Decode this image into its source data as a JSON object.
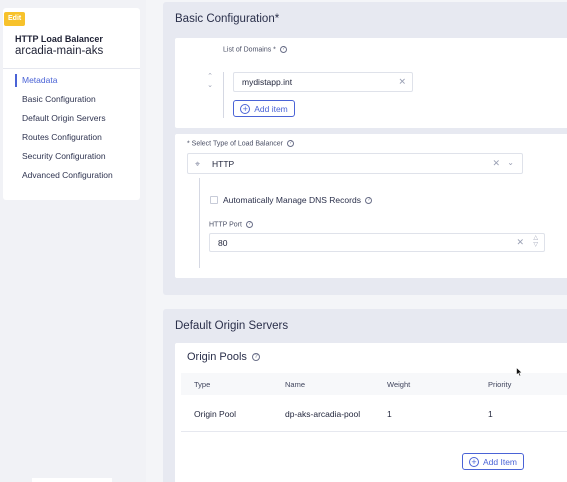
{
  "sidebar": {
    "badge": "Edit",
    "object_type": "HTTP Load Balancer",
    "object_name": "arcadia-main-aks",
    "items": [
      {
        "label": "Metadata",
        "active": true
      },
      {
        "label": "Basic Configuration",
        "active": false
      },
      {
        "label": "Default Origin Servers",
        "active": false
      },
      {
        "label": "Routes Configuration",
        "active": false
      },
      {
        "label": "Security Configuration",
        "active": false
      },
      {
        "label": "Advanced Configuration",
        "active": false
      }
    ]
  },
  "basic": {
    "title": "Basic Configuration*",
    "domains_label": "List of Domains *",
    "domain_value": "mydistapp.int",
    "add_item": "Add item",
    "lb_type_label": "* Select Type of Load Balancer",
    "lb_type_value": "HTTP",
    "dns_label": "Automatically Manage DNS Records",
    "port_label": "HTTP Port",
    "port_value": "80"
  },
  "origin": {
    "title": "Default Origin Servers",
    "pools_title": "Origin Pools",
    "columns": [
      "Type",
      "Name",
      "Weight",
      "Priority"
    ],
    "rows": [
      {
        "type": "Origin Pool",
        "name": "dp-aks-arcadia-pool",
        "weight": "1",
        "priority": "1"
      }
    ],
    "add_item": "Add Item"
  },
  "colors": {
    "accent": "#4a63d6",
    "badge": "#f7c22b"
  },
  "icons": [
    "info-icon",
    "chevron-up-icon",
    "chevron-down-icon",
    "clear-icon",
    "add-circle-icon",
    "load-balancer-type-icon",
    "dropdown-chevron-icon",
    "stepper-icon",
    "mouse-cursor-icon"
  ]
}
